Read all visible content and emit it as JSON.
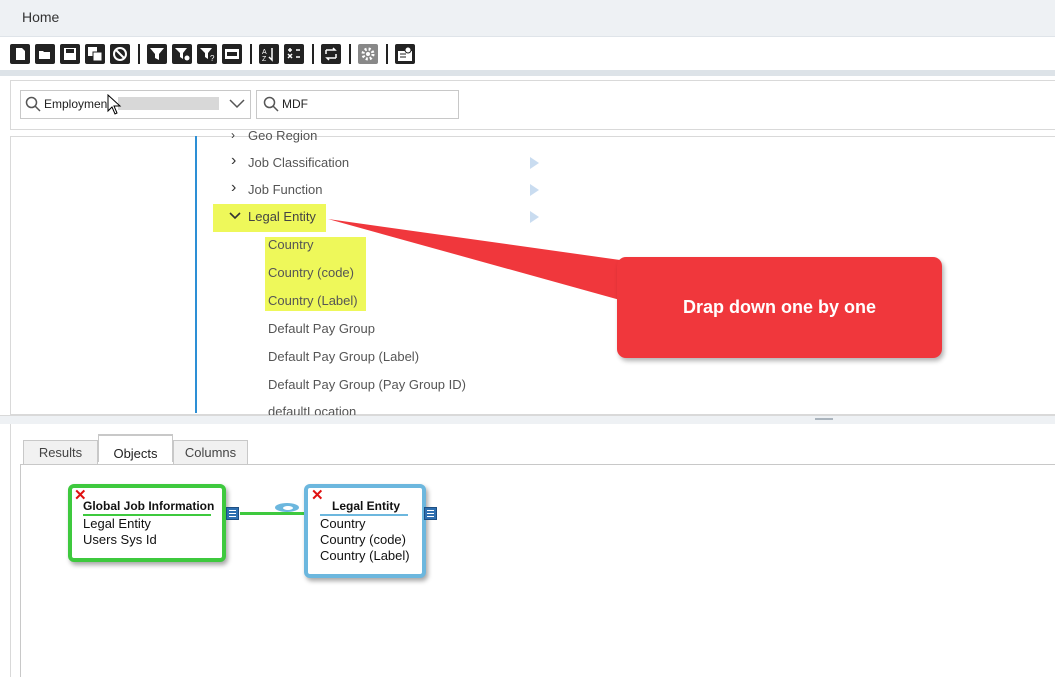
{
  "header": {
    "home_label": "Home"
  },
  "toolbar": {
    "buttons": [
      "new-document-icon",
      "open-folder-icon",
      "save-icon",
      "save-all-icon",
      "cancel-icon",
      "filter-icon",
      "filter-settings-icon",
      "filter-help-icon",
      "date-format-icon",
      "sort-icon",
      "calculate-icon",
      "refresh-icon",
      "settings-icon",
      "report-layout-icon"
    ]
  },
  "search": {
    "select_value": "Employmen",
    "filter_value": "MDF"
  },
  "tree": {
    "items": [
      {
        "label": "Geo Region",
        "level": 1,
        "expanded": false
      },
      {
        "label": "Job Classification",
        "level": 1,
        "expanded": false
      },
      {
        "label": "Job Function",
        "level": 1,
        "expanded": false
      },
      {
        "label": "Legal Entity",
        "level": 1,
        "expanded": true,
        "highlighted": true
      },
      {
        "label": "Country",
        "level": 2,
        "highlighted": true
      },
      {
        "label": "Country (code)",
        "level": 2,
        "highlighted": true
      },
      {
        "label": "Country (Label)",
        "level": 2,
        "highlighted": true
      },
      {
        "label": "Default Pay Group",
        "level": 2
      },
      {
        "label": "Default Pay Group (Label)",
        "level": 2
      },
      {
        "label": "Default Pay Group (Pay Group ID)",
        "level": 2
      },
      {
        "label": "defaultLocation",
        "level": 2
      }
    ]
  },
  "callout": {
    "text": "Drap down one by one",
    "color": "#f0373c"
  },
  "tabs": [
    {
      "label": "Results",
      "active": false
    },
    {
      "label": "Objects",
      "active": true
    },
    {
      "label": "Columns",
      "active": false
    }
  ],
  "objects": [
    {
      "title": "Global Job Information",
      "border_color": "#3ec93e",
      "fields": [
        "Legal Entity",
        "Users Sys Id"
      ]
    },
    {
      "title": "Legal Entity",
      "border_color": "#6cb7de",
      "fields": [
        "Country",
        "Country (code)",
        "Country (Label)"
      ]
    }
  ]
}
